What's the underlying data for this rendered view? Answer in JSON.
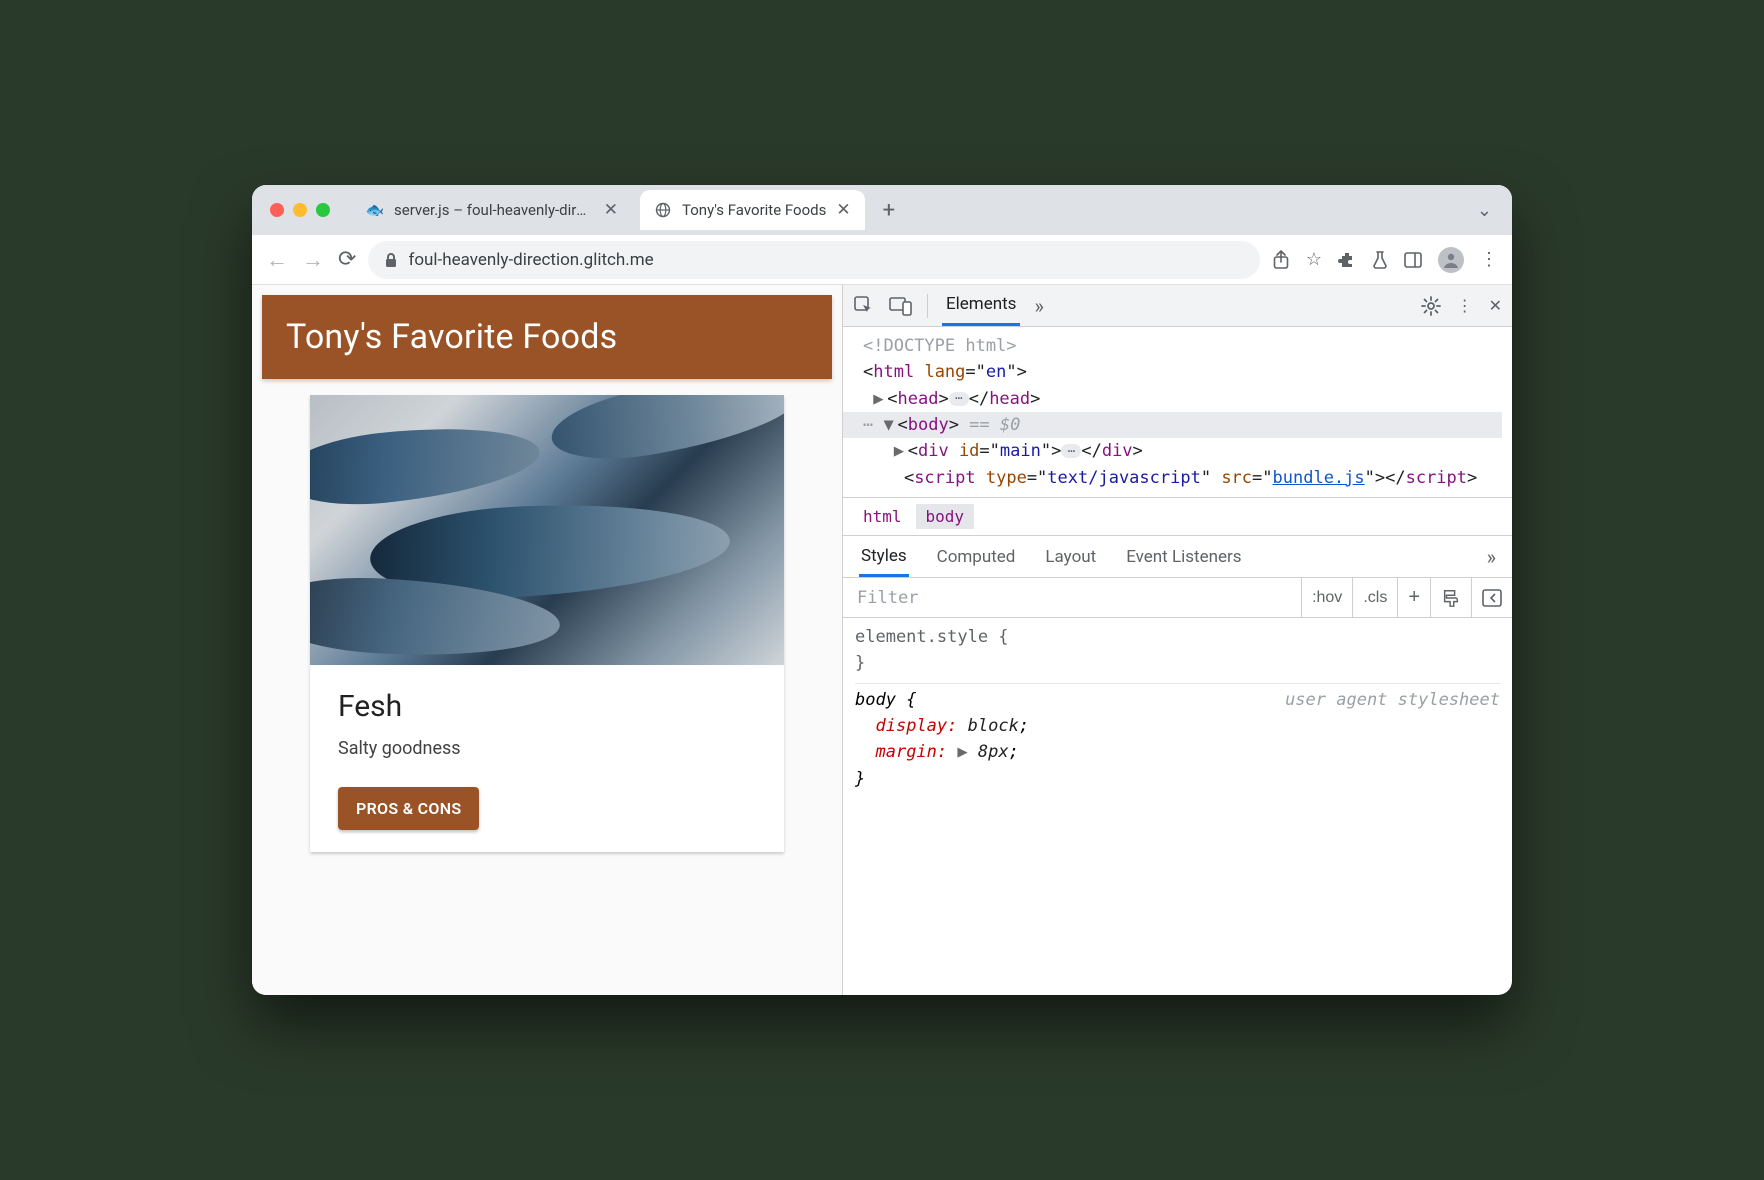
{
  "tabs": [
    {
      "title": "server.js – foul-heavenly-direct",
      "active": false
    },
    {
      "title": "Tony's Favorite Foods",
      "active": true
    }
  ],
  "toolbar": {
    "url": "foul-heavenly-direction.glitch.me"
  },
  "page": {
    "hero": "Tony's Favorite Foods",
    "card": {
      "title": "Fesh",
      "desc": "Salty goodness",
      "button": "PROS & CONS"
    }
  },
  "devtools": {
    "panel": "Elements",
    "dom": {
      "doctype": "<!DOCTYPE html>",
      "html_open": "html",
      "html_lang": "en",
      "head": "head",
      "body": "body",
      "selected_marker": "== $0",
      "div_id": "main",
      "script_type": "text/javascript",
      "script_src": "bundle.js"
    },
    "crumbs": [
      "html",
      "body"
    ],
    "styles_tabs": [
      "Styles",
      "Computed",
      "Layout",
      "Event Listeners"
    ],
    "filter_placeholder": "Filter",
    "filter_controls": {
      "hov": ":hov",
      "cls": ".cls"
    },
    "styles": {
      "element_style": "element.style",
      "body_selector": "body",
      "ua_label": "user agent stylesheet",
      "props": [
        {
          "name": "display",
          "value": "block"
        },
        {
          "name": "margin",
          "value": "8px",
          "expandable": true
        }
      ]
    }
  }
}
